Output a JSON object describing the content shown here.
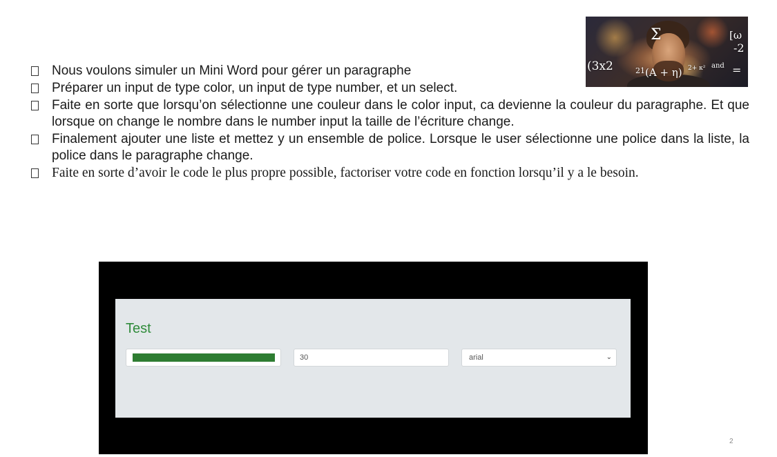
{
  "meme": {
    "equation_1": "(3x2",
    "equation_2": "21",
    "equation_3": "(A + η)",
    "equation_4": "2+ κ²",
    "equation_5": "and",
    "equation_6": "=",
    "equation_7": "[ω",
    "equation_8": "-2",
    "equation_9": "Σ"
  },
  "bullets": [
    "Nous voulons simuler un Mini Word pour gérer un paragraphe",
    "Préparer un input de type color, un input de type number, et un select.",
    "Faite en sorte que lorsqu’on sélectionne une couleur dans le color input, ca devienne la couleur du paragraphe. Et que lorsque on change le nombre dans le number input la taille de l’écriture change.",
    "Finalement ajouter une liste et mettez y un ensemble de police. Lorsque le user sélectionne une police dans la liste, la police dans le paragraphe change.",
    "Faite en sorte d’avoir le code le plus propre possible, factoriser votre code en fonction lorsqu’il y a le besoin."
  ],
  "demo": {
    "paragraph_text": "Test",
    "color_value": "#2e7d32",
    "number_value": "30",
    "font_selected": "arial"
  },
  "slide_number": "2"
}
